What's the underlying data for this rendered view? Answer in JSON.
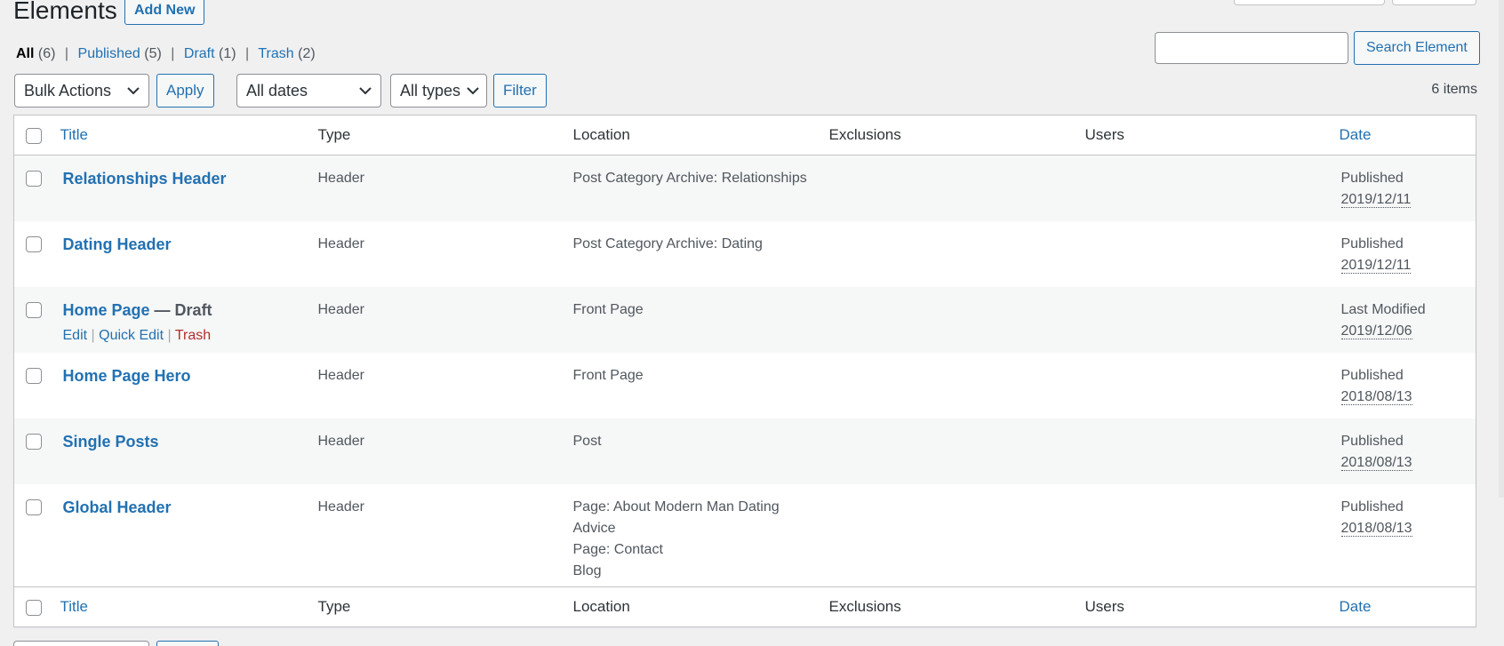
{
  "page": {
    "title": "Elements",
    "add_new_label": "Add New"
  },
  "views": [
    {
      "label": "All",
      "count": "(6)",
      "current": true
    },
    {
      "label": "Published",
      "count": "(5)",
      "current": false
    },
    {
      "label": "Draft",
      "count": "(1)",
      "current": false
    },
    {
      "label": "Trash",
      "count": "(2)",
      "current": false
    }
  ],
  "search": {
    "value": "",
    "button_label": "Search Element"
  },
  "tablenav": {
    "bulk_actions": "Bulk Actions",
    "apply_label": "Apply",
    "dates_filter": "All dates",
    "types_filter": "All types",
    "filter_label": "Filter",
    "items_count": "6 items"
  },
  "columns": {
    "title": "Title",
    "type": "Type",
    "location": "Location",
    "exclusions": "Exclusions",
    "users": "Users",
    "date": "Date"
  },
  "rows": [
    {
      "title": "Relationships Header",
      "state": "",
      "type": "Header",
      "location": [
        "Post Category Archive: Relationships"
      ],
      "exclusions": "",
      "users": "",
      "date_status": "Published",
      "date": "2019/12/11"
    },
    {
      "title": "Dating Header",
      "state": "",
      "type": "Header",
      "location": [
        "Post Category Archive: Dating"
      ],
      "exclusions": "",
      "users": "",
      "date_status": "Published",
      "date": "2019/12/11"
    },
    {
      "title": "Home Page",
      "state": " — Draft",
      "type": "Header",
      "location": [
        "Front Page"
      ],
      "exclusions": "",
      "users": "",
      "date_status": "Last Modified",
      "date": "2019/12/06",
      "actions": {
        "edit": "Edit",
        "quick_edit": "Quick Edit",
        "trash": "Trash"
      }
    },
    {
      "title": "Home Page Hero",
      "state": "",
      "type": "Header",
      "location": [
        "Front Page"
      ],
      "exclusions": "",
      "users": "",
      "date_status": "Published",
      "date": "2018/08/13"
    },
    {
      "title": "Single Posts",
      "state": "",
      "type": "Header",
      "location": [
        "Post"
      ],
      "exclusions": "",
      "users": "",
      "date_status": "Published",
      "date": "2018/08/13"
    },
    {
      "title": "Global Header",
      "state": "",
      "type": "Header",
      "location": [
        "Page: About Modern Man Dating",
        "Advice",
        "Page: Contact",
        "Blog"
      ],
      "exclusions": "",
      "users": "",
      "date_status": "Published",
      "date": "2018/08/13"
    }
  ],
  "colors": {
    "accent": "#2271b1",
    "danger": "#b32d2e",
    "background": "#f0f0f1"
  }
}
